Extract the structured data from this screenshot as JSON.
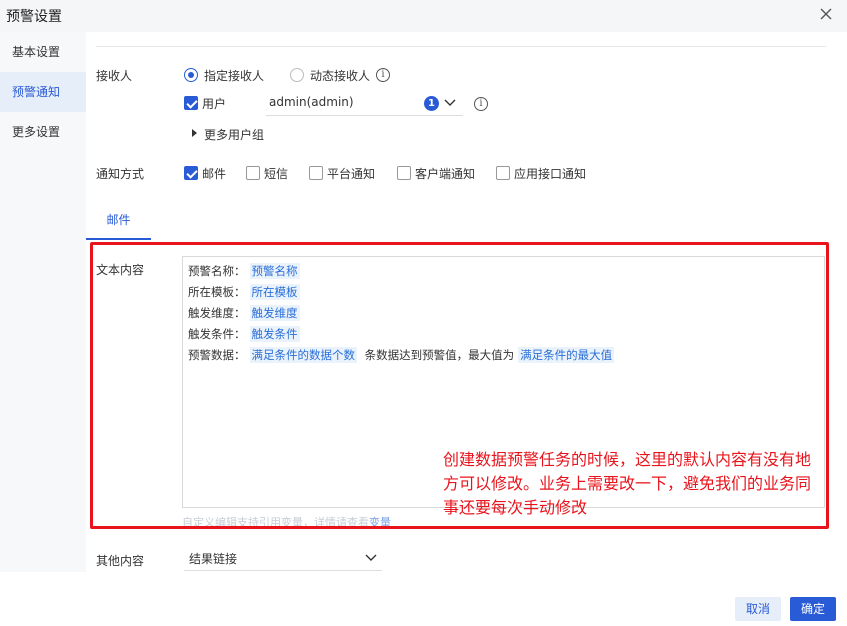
{
  "dialog": {
    "title": "预警设置"
  },
  "sidebar": {
    "items": [
      {
        "label": "基本设置"
      },
      {
        "label": "预警通知"
      },
      {
        "label": "更多设置"
      }
    ]
  },
  "receiver": {
    "label": "接收人",
    "option_fixed": "指定接收人",
    "option_dynamic": "动态接收人",
    "user_label": "用户",
    "user_value": "admin(admin)",
    "user_count": "1",
    "more_groups": "更多用户组"
  },
  "notify": {
    "label": "通知方式",
    "options": [
      "邮件",
      "短信",
      "平台通知",
      "客户端通知",
      "应用接口通知"
    ]
  },
  "tabs": {
    "email": "邮件"
  },
  "text_content": {
    "label": "文本内容",
    "rows": [
      {
        "key": "预警名称：",
        "var": "预警名称"
      },
      {
        "key": "所在模板：",
        "var": "所在模板"
      },
      {
        "key": "触发维度：",
        "var": "触发维度"
      },
      {
        "key": "触发条件：",
        "var": "触发条件"
      }
    ],
    "data_row": {
      "key": "预警数据：",
      "var1": "满足条件的数据个数",
      "mid": "条数据达到预警值，最大值为",
      "var2": "满足条件的最大值"
    },
    "hint": "自定义编辑支持引用变量，详情请查看",
    "hint_link": "变量"
  },
  "annotation": "创建数据预警任务的时候，这里的默认内容有没有地方可以修改。业务上需要改一下，避免我们的业务同事还要每次手动修改",
  "other": {
    "label": "其他内容",
    "value": "结果链接"
  },
  "footer": {
    "cancel": "取消",
    "ok": "确定"
  },
  "colors": {
    "accent": "#2a5bd7",
    "annotation": "#e8141c"
  }
}
